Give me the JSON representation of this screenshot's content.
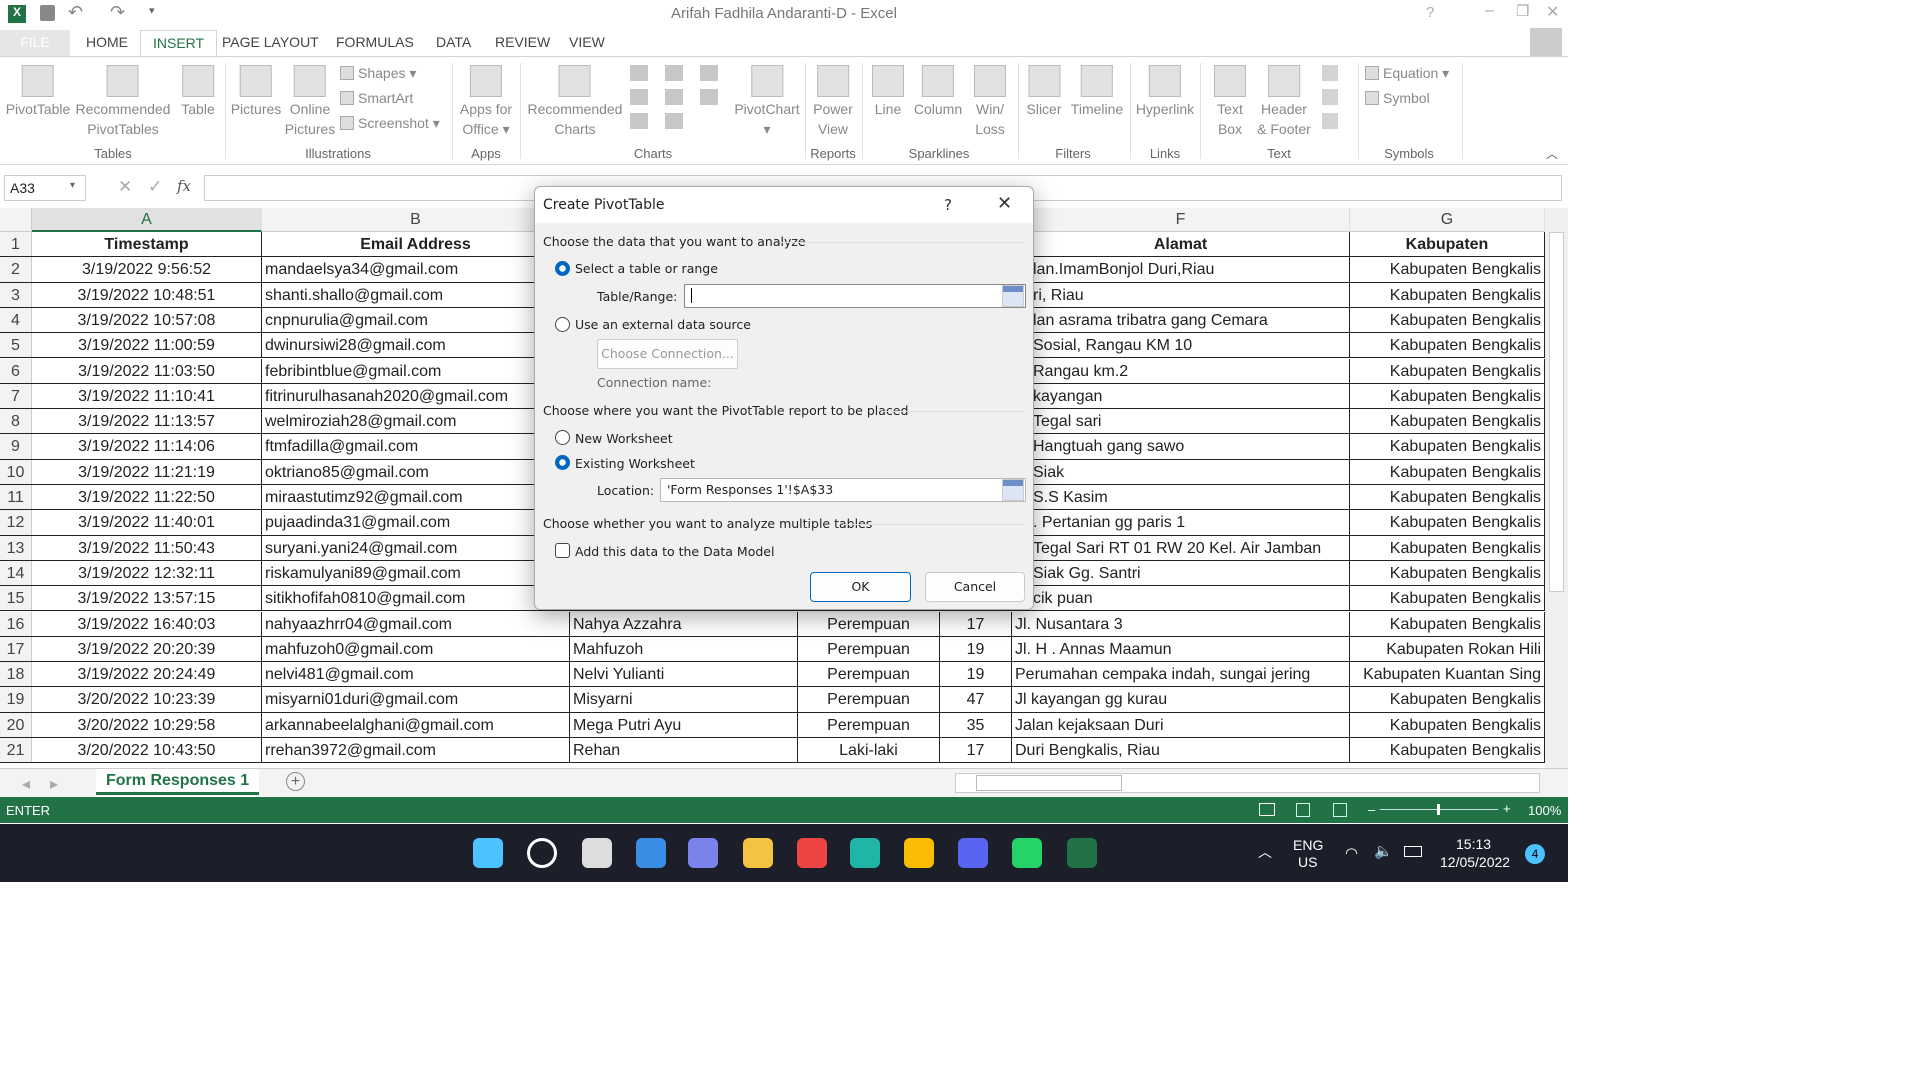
{
  "window": {
    "title": "Arifah Fadhila Andaranti-D - Excel",
    "help": "?"
  },
  "tabs": [
    "FILE",
    "HOME",
    "INSERT",
    "PAGE LAYOUT",
    "FORMULAS",
    "DATA",
    "REVIEW",
    "VIEW"
  ],
  "active_tab": "INSERT",
  "ribbon": {
    "groups": [
      "Tables",
      "Illustrations",
      "Apps",
      "Charts",
      "Reports",
      "Sparklines",
      "Filters",
      "Links",
      "Text",
      "Symbols"
    ],
    "buttons": [
      "PivotTable",
      "Recommended\nPivotTables",
      "Table",
      "Pictures",
      "Online\nPictures",
      "Apps for\nOffice ▾",
      "Recommended\nCharts",
      "PivotChart\n▾",
      "Power\nView",
      "Line",
      "Column",
      "Win/\nLoss",
      "Slicer",
      "Timeline",
      "Hyperlink",
      "Text\nBox",
      "Header\n& Footer"
    ],
    "small": [
      "Shapes ▾",
      "SmartArt",
      "Screenshot ▾",
      "Equation ▾",
      "Symbol"
    ]
  },
  "formula_bar": {
    "name_box": "A33",
    "fx": "fx",
    "value": ""
  },
  "columns": [
    "A",
    "B",
    "C",
    "D",
    "E",
    "F",
    "G"
  ],
  "selected_column": "A",
  "header_row": [
    "Timestamp",
    "Email Address",
    "",
    "",
    "",
    "Alamat",
    "Kabupaten"
  ],
  "rows": [
    [
      "3/19/2022 9:56:52",
      "mandaelsya34@gmail.com",
      "",
      "",
      "",
      "lan.ImamBonjol Duri,Riau",
      "Kabupaten Bengkalis"
    ],
    [
      "3/19/2022 10:48:51",
      "shanti.shallo@gmail.com",
      "",
      "",
      "",
      "ri, Riau",
      "Kabupaten Bengkalis"
    ],
    [
      "3/19/2022 10:57:08",
      "cnpnurulia@gmail.com",
      "",
      "",
      "",
      "lan asrama tribatra gang Cemara",
      "Kabupaten Bengkalis"
    ],
    [
      "3/19/2022 11:00:59",
      "dwinursiwi28@gmail.com",
      "",
      "",
      "",
      " Sosial, Rangau KM 10",
      "Kabupaten Bengkalis"
    ],
    [
      "3/19/2022 11:03:50",
      "febribintblue@gmail.com",
      "",
      "",
      "",
      " Rangau km.2",
      "Kabupaten Bengkalis"
    ],
    [
      "3/19/2022 11:10:41",
      "fitrinurulhasanah2020@gmail.com",
      "",
      "",
      "",
      "kayangan",
      "Kabupaten Bengkalis"
    ],
    [
      "3/19/2022 11:13:57",
      "welmiroziah28@gmail.com",
      "",
      "",
      "",
      "Tegal sari",
      "Kabupaten Bengkalis"
    ],
    [
      "3/19/2022 11:14:06",
      "ftmfadilla@gmail.com",
      "",
      "",
      "",
      "Hangtuah gang sawo",
      "Kabupaten Bengkalis"
    ],
    [
      "3/19/2022 11:21:19",
      "oktriano85@gmail.com",
      "",
      "",
      "",
      " Siak",
      "Kabupaten Bengkalis"
    ],
    [
      "3/19/2022 11:22:50",
      "miraastutimz92@gmail.com",
      "",
      "",
      "",
      " S.S Kasim",
      "Kabupaten Bengkalis"
    ],
    [
      "3/19/2022 11:40:01",
      "pujaadinda31@gmail.com",
      "",
      "",
      "",
      ". Pertanian gg paris 1",
      "Kabupaten Bengkalis"
    ],
    [
      "3/19/2022 11:50:43",
      "suryani.yani24@gmail.com",
      "",
      "",
      "",
      " Tegal Sari RT 01 RW 20 Kel. Air Jamban",
      "Kabupaten Bengkalis"
    ],
    [
      "3/19/2022 12:32:11",
      "riskamulyani89@gmail.com",
      "",
      "",
      "",
      " Siak Gg. Santri",
      "Kabupaten Bengkalis"
    ],
    [
      "3/19/2022 13:57:15",
      "sitikhofifah0810@gmail.com",
      "",
      "",
      "",
      "cik puan",
      "Kabupaten Bengkalis"
    ],
    [
      "3/19/2022 16:40:03",
      "nahyaazhrr04@gmail.com",
      "Nahya Azzahra",
      "Perempuan",
      "17",
      "Jl. Nusantara 3",
      "Kabupaten Bengkalis"
    ],
    [
      "3/19/2022 20:20:39",
      "mahfuzoh0@gmail.com",
      "Mahfuzoh",
      "Perempuan",
      "19",
      "Jl. H . Annas Maamun",
      "Kabupaten Rokan Hili"
    ],
    [
      "3/19/2022 20:24:49",
      "nelvi481@gmail.com",
      "Nelvi Yulianti",
      "Perempuan",
      "19",
      "Perumahan cempaka indah, sungai jering",
      "Kabupaten Kuantan Sing"
    ],
    [
      "3/20/2022 10:23:39",
      "misyarni01duri@gmail.com",
      "Misyarni",
      "Perempuan",
      "47",
      "Jl kayangan gg kurau",
      "Kabupaten Bengkalis"
    ],
    [
      "3/20/2022 10:29:58",
      "arkannabeelalghani@gmail.com",
      "Mega Putri Ayu",
      "Perempuan",
      "35",
      "Jalan kejaksaan Duri",
      "Kabupaten Bengkalis"
    ],
    [
      "3/20/2022 10:43:50",
      "rrehan3972@gmail.com",
      "Rehan",
      "Laki-laki",
      "17",
      "Duri Bengkalis, Riau",
      "Kabupaten Bengkalis"
    ]
  ],
  "sheet_tabs": [
    "Form Responses 1"
  ],
  "status": {
    "mode": "ENTER",
    "zoom": "100%"
  },
  "dialog": {
    "title": "Create PivotTable",
    "help": "?",
    "section1": "Choose the data that you want to analyze",
    "opt_table": "Select a table or range",
    "table_range_label": "Table/Range:",
    "table_range_value": "",
    "opt_external": "Use an external data source",
    "choose_connection": "Choose Connection...",
    "connection_name": "Connection name:",
    "section2": "Choose where you want the PivotTable report to be placed",
    "opt_new": "New Worksheet",
    "opt_existing": "Existing Worksheet",
    "location_label": "Location:",
    "location_value": "'Form Responses 1'!$A$33",
    "section3": "Choose whether you want to analyze multiple tables",
    "data_model": "Add this data to the Data Model",
    "data_model_checked": false,
    "ok": "OK",
    "cancel": "Cancel",
    "selected_source": "table",
    "selected_destination": "existing"
  },
  "taskbar": {
    "lang1": "ENG",
    "lang2": "US",
    "time": "15:13",
    "date": "12/05/2022",
    "notifications": "4",
    "apps": [
      "windows-start",
      "search",
      "task-view",
      "widgets",
      "teams-chat",
      "file-explorer",
      "chrome-profile",
      "edge",
      "chrome",
      "discord",
      "whatsapp",
      "excel"
    ]
  },
  "colors": {
    "accent": "#217346",
    "dialog_accent": "#0067c0",
    "taskbar": "#1c1f2a"
  }
}
